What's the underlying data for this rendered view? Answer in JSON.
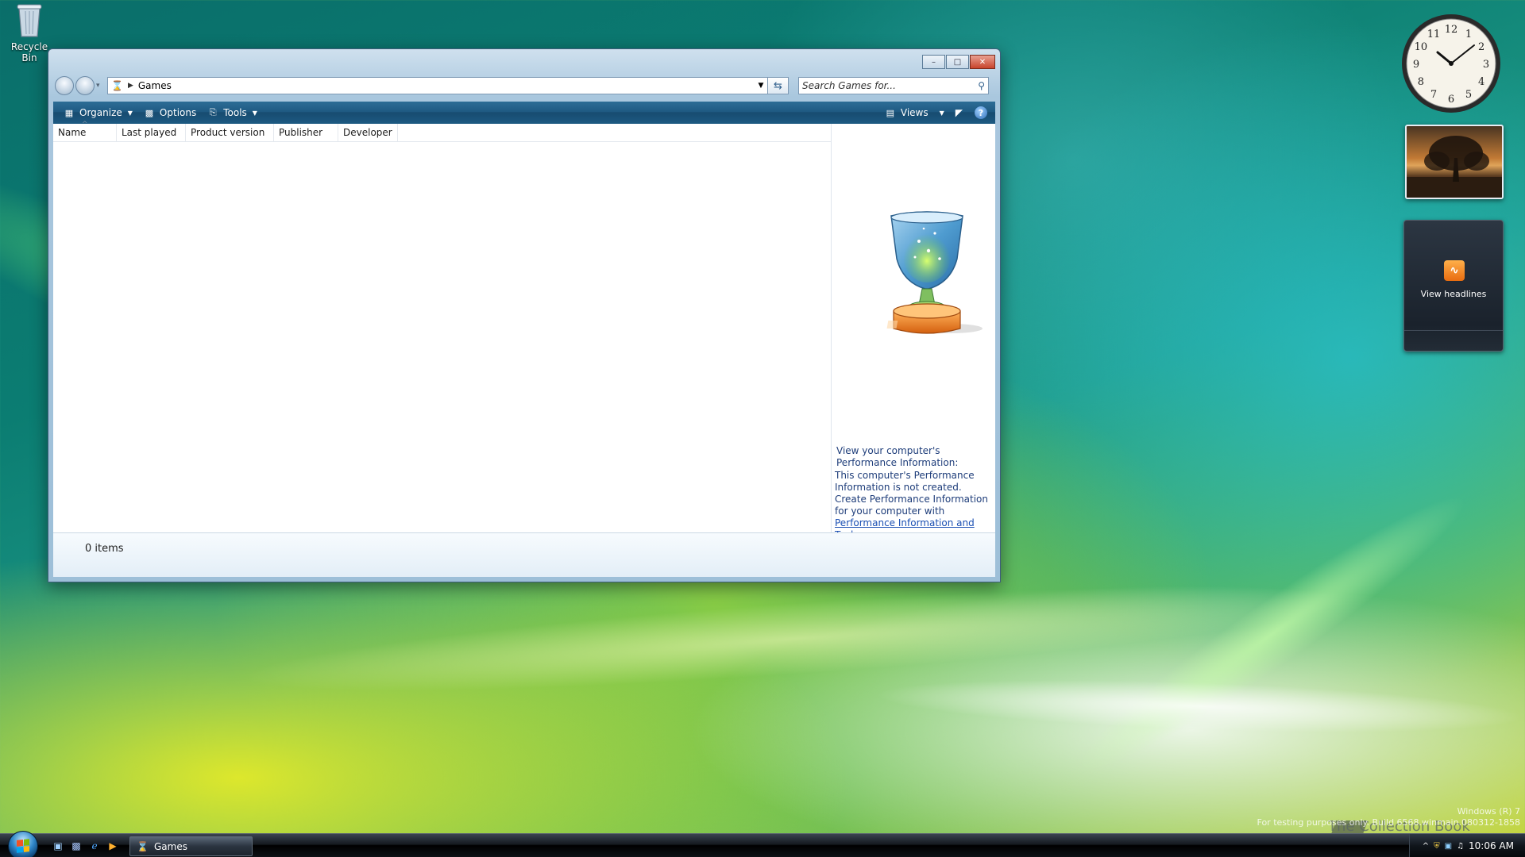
{
  "desktop": {
    "recycle_bin_label": "Recycle Bin"
  },
  "window": {
    "address": {
      "crumb": "Games",
      "search_placeholder": "Search Games for..."
    },
    "toolbar": {
      "organize": "Organize",
      "options": "Options",
      "tools": "Tools",
      "views": "Views"
    },
    "columns": [
      "Name",
      "Last played",
      "Product version",
      "Publisher",
      "Developer"
    ],
    "preview": {
      "perf_title": "View your computer's Performance Information:",
      "perf_line1": "This computer's Performance Information is not created.",
      "perf_line2": "Create Performance Information for your computer with ",
      "perf_link": "Performance Information and Tools",
      "perf_end": "."
    },
    "status": {
      "count": "0 items"
    }
  },
  "gadgets": {
    "feed_label": "View headlines",
    "clock_numbers": [
      "12",
      "1",
      "2",
      "3",
      "4",
      "5",
      "6",
      "7",
      "8",
      "9",
      "10",
      "11"
    ]
  },
  "watermark": {
    "line1": "Windows (R) 7",
    "line2": "For testing purposes only. Build 6568.winmain.080312-1858",
    "collection": "The Collection Book"
  },
  "taskbar": {
    "task_label": "Games",
    "time": "10:06 AM"
  },
  "colors": {
    "toolbar": "#1f5a83",
    "link": "#1a4fb3",
    "text_blue": "#1e3d7a"
  }
}
